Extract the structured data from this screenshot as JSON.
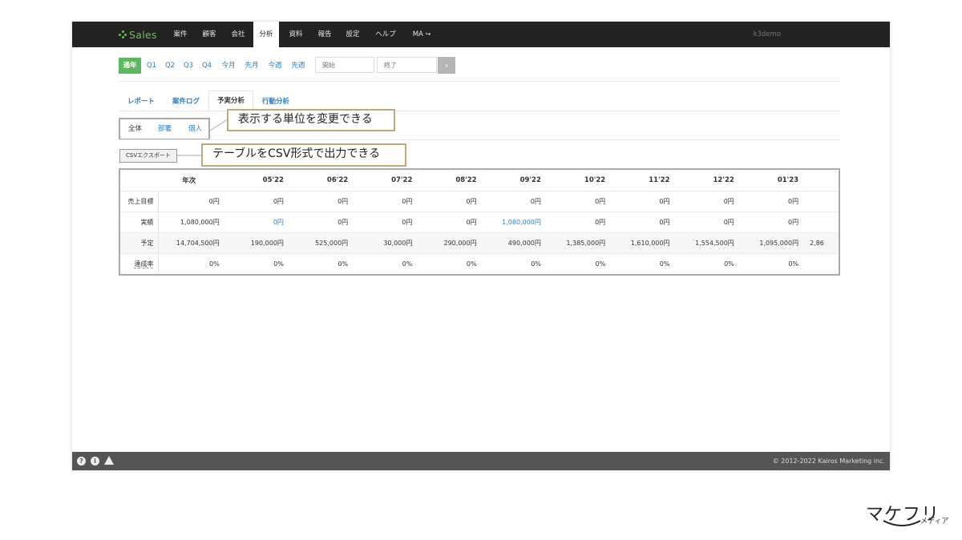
{
  "app": {
    "brand": "Sales",
    "nav": [
      "案件",
      "顧客",
      "会社",
      "分析",
      "資料",
      "報告",
      "設定",
      "ヘルプ",
      "MA"
    ],
    "active_nav": "分析",
    "user": "k3demo",
    "brand_color": "#6ac259",
    "nav_bg": "#222222"
  },
  "period": {
    "options": [
      "通年",
      "Q1",
      "Q2",
      "Q3",
      "Q4",
      "今月",
      "先月",
      "今週",
      "先週"
    ],
    "active": "通年",
    "start_placeholder": "開始",
    "end_placeholder": "終了",
    "go_label": "›"
  },
  "tabs": [
    "レポート",
    "案件ログ",
    "予実分析",
    "行動分析"
  ],
  "active_tab": "予実分析",
  "scope": {
    "items": [
      "全体",
      "部署",
      "個人"
    ],
    "active": "全体"
  },
  "callouts": {
    "scope": "表示する単位を変更できる",
    "csv": "テーブルをCSV形式で出力できる"
  },
  "csv_button": "CSVエクスポート",
  "table": {
    "headers": [
      "年次",
      "05'22",
      "06'22",
      "07'22",
      "08'22",
      "09'22",
      "10'22",
      "11'22",
      "12'22",
      "01'23"
    ],
    "rows": [
      {
        "label": "売上目標",
        "cells": [
          "0円",
          "0円",
          "0円",
          "0円",
          "0円",
          "0円",
          "0円",
          "0円",
          "0円",
          "0円"
        ],
        "extra": ""
      },
      {
        "label": "実績",
        "cells": [
          "1,080,000円",
          "0円",
          "0円",
          "0円",
          "0円",
          "1,080,000円",
          "0円",
          "0円",
          "0円",
          "0円"
        ],
        "extra": ""
      },
      {
        "label": "予定",
        "cells": [
          "14,704,500円",
          "190,000円",
          "525,000円",
          "30,000円",
          "290,000円",
          "490,000円",
          "1,385,000円",
          "1,610,000円",
          "1,554,500円",
          "1,095,000円"
        ],
        "extra": "2,86"
      },
      {
        "label": "達成率",
        "cells": [
          "0%",
          "0%",
          "0%",
          "0%",
          "0%",
          "0%",
          "0%",
          "0%",
          "0%",
          "0%"
        ],
        "extra": ""
      }
    ],
    "link_color": "#2a7fc4"
  },
  "footer": {
    "icons": [
      "help-icon",
      "info-icon",
      "warning-icon"
    ],
    "copyright": "© 2012-2022 Kairos Marketing inc."
  },
  "watermark": {
    "main": "マケフリ",
    "sub": "メディア"
  }
}
